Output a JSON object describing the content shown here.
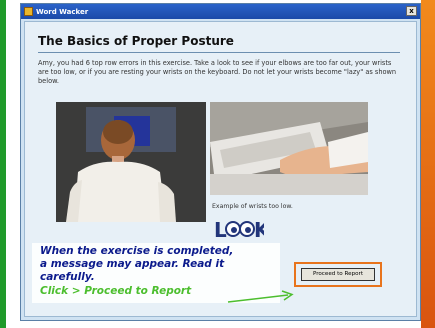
{
  "window": {
    "title": "Word Wacker",
    "close_label": "x"
  },
  "lesson": {
    "heading": "The Basics of Proper Posture",
    "intro": "Amy, you had 6 top row errors in this exercise. Take a look to see if your elbows are too far out, your wrists are too low, or if you are resting your wrists on the keyboard. Do not let your wrists become \"lazy\" as shown below.",
    "caption": "Example of wrists too low.",
    "look_text": "LOOK",
    "proceed_label": "Proceed to Report"
  },
  "note": {
    "line1": "When the exercise is completed,",
    "line2": "a message may appear.  Read it",
    "line3": "carefully.",
    "line4": "Click > Proceed to Report"
  },
  "colors": {
    "note_text": "#0b1a8c",
    "note_green": "#4cbe2e",
    "highlight_frame": "#e8741d",
    "left_stripe": "#1f9a2a",
    "right_stripe": "#e06a14"
  }
}
